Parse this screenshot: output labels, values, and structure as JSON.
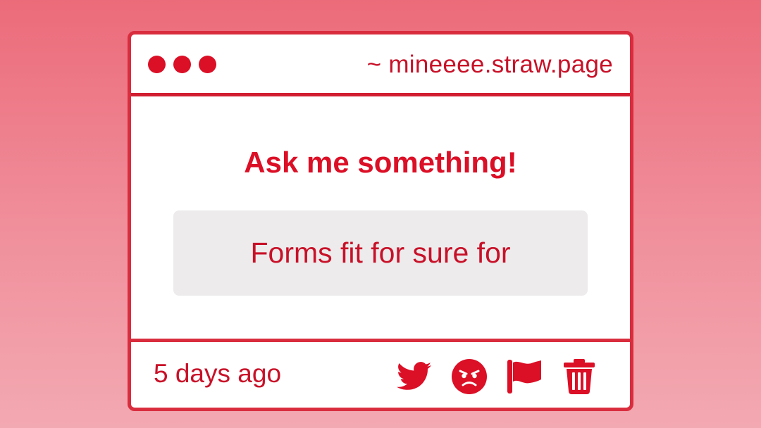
{
  "window": {
    "url": "~ mineeee.straw.page"
  },
  "main": {
    "heading": "Ask me something!",
    "answer": "Forms fit for sure for"
  },
  "footer": {
    "timestamp": "5 days ago",
    "actions": [
      {
        "icon": "twitter-icon"
      },
      {
        "icon": "angry-face-icon"
      },
      {
        "icon": "flag-icon"
      },
      {
        "icon": "trash-icon"
      }
    ]
  },
  "colors": {
    "accent": "#db0f26",
    "border": "#d92d3e",
    "box_background": "#edebec",
    "page_gradient_top": "#ec6b7a",
    "page_gradient_bottom": "#f3a9b2"
  }
}
